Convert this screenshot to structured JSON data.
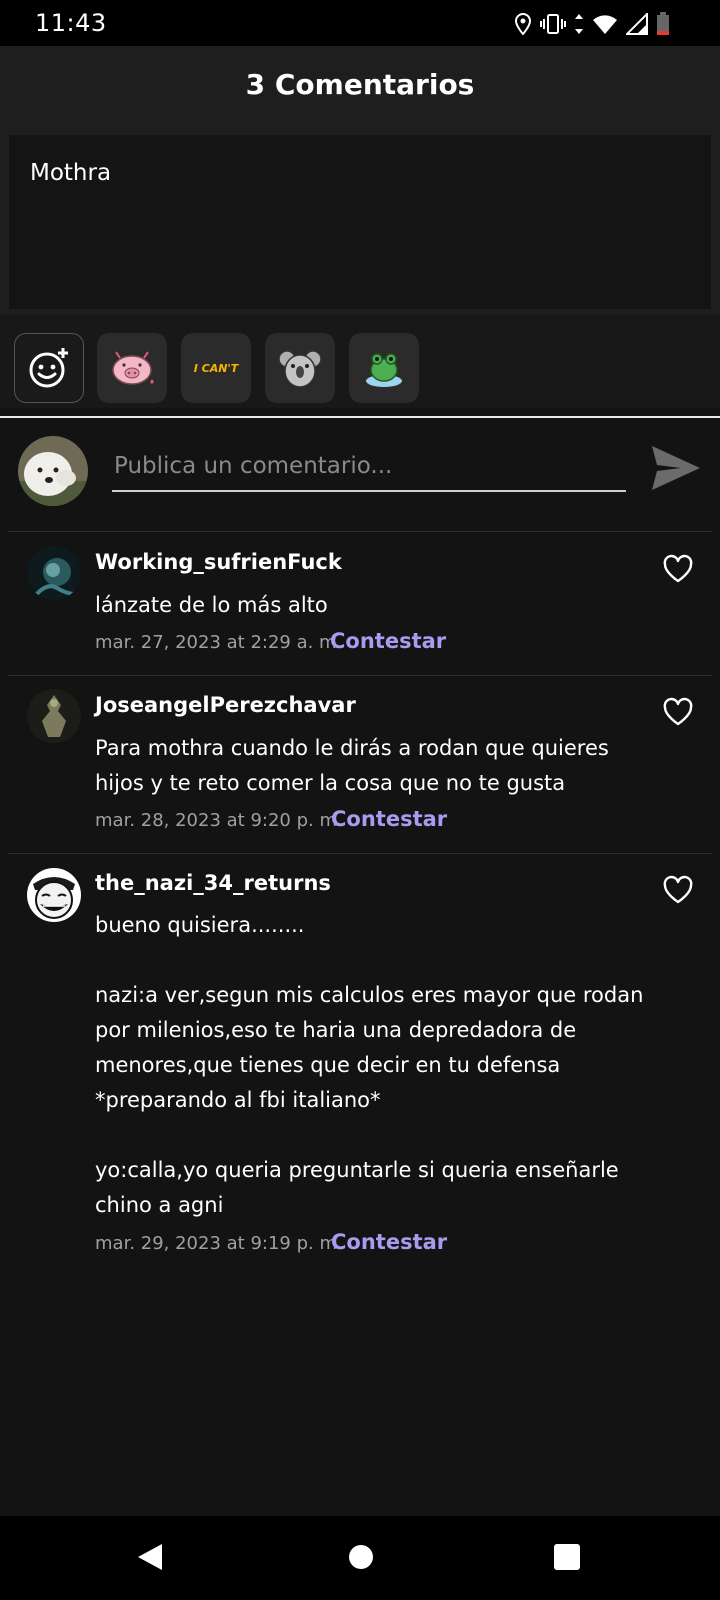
{
  "status": {
    "time": "11:43"
  },
  "header": {
    "title": "3 Comentarios"
  },
  "post": {
    "text": "Mothra"
  },
  "stickers": [
    {
      "name": "emoji-picker-icon"
    },
    {
      "name": "pig-sticker"
    },
    {
      "name": "i-cant-sticker",
      "text": "I CAN'T"
    },
    {
      "name": "koala-sticker"
    },
    {
      "name": "frog-sticker"
    }
  ],
  "composer": {
    "placeholder": "Publica un comentario..."
  },
  "comments": [
    {
      "user": "Working_sufrienFuck",
      "text": "lánzate de lo más alto",
      "date": "mar. 27, 2023 at 2:29 a. m.",
      "reply": "Contestar"
    },
    {
      "user": "JoseangelPerezchavar",
      "text": "Para mothra cuando le dirás a rodan que quieres hijos y te reto comer la cosa que no te gusta",
      "date": "mar. 28, 2023 at 9:20 p. m.",
      "reply": "Contestar"
    },
    {
      "user": "the_nazi_34_returns",
      "text": "bueno quisiera........\n\nnazi:a ver,segun mis calculos eres mayor que rodan por milenios,eso te haria una depredadora de menores,que tienes que decir en tu defensa *preparando al fbi italiano*\n\nyo:calla,yo queria preguntarle si queria enseñarle chino a agni",
      "date": "mar. 29, 2023 at 9:19 p. m.",
      "reply": "Contestar"
    }
  ],
  "colors": {
    "accent": "#a99cf0",
    "background": "#131313",
    "header": "#1e1e1e"
  }
}
